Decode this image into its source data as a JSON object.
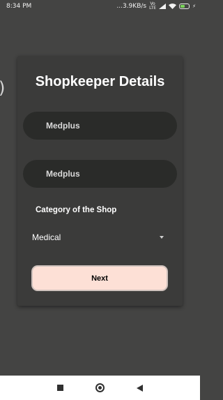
{
  "status_bar": {
    "time": "8:34 PM",
    "net_speed": "...3.9KB/s",
    "vo_label": "Vo",
    "lte_label": "LTE",
    "sim_icon": "sim-icon",
    "wifi_icon": "wifi-icon",
    "battery_icon": "battery-icon"
  },
  "background": {
    "partial_glyph": ")"
  },
  "form": {
    "title": "Shopkeeper Details",
    "field_1_value": "Medplus",
    "field_2_value": "Medplus",
    "category_label": "Category of the Shop",
    "category_selected": "Medical",
    "next_label": "Next"
  },
  "nav_bar": {
    "recents_icon": "square-icon",
    "home_icon": "circle-icon",
    "back_icon": "triangle-back-icon"
  },
  "colors": {
    "background": "#444443",
    "card": "#3b3b3a",
    "input_fill": "#2a2b29",
    "button_fill": "#fde0d6",
    "nav_bar": "#ffffff"
  }
}
